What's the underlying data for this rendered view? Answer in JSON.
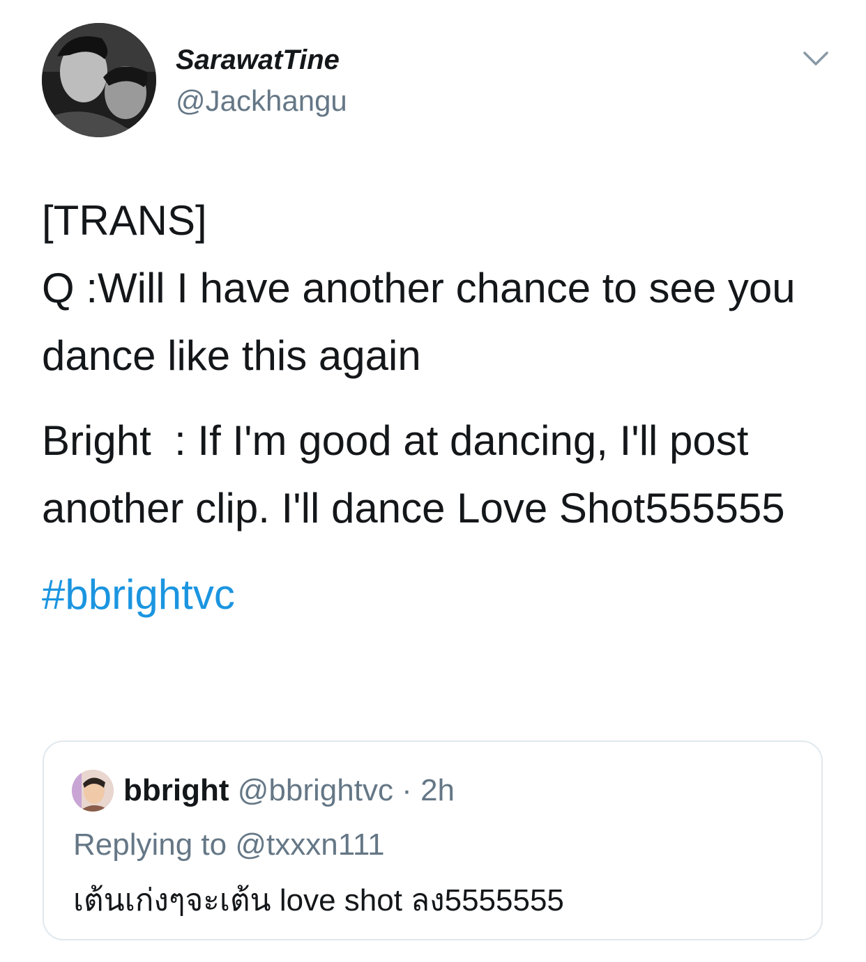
{
  "author": {
    "display_name": "SarawatTine",
    "handle": "@Jackhangu",
    "avatar_icon": "profile-photo"
  },
  "menu": {
    "icon": "chevron-down-icon"
  },
  "tweet": {
    "line1": "[TRANS]",
    "line2": "Q :Will I have another chance to see you dance like this again",
    "line3": "Bright  : If I'm good at dancing, I'll post another clip. I'll dance Love Shot555555",
    "hashtag": "#bbrightvc",
    "hashtag_color": "#1b95e0"
  },
  "quote": {
    "name": "bbright",
    "handle": "@bbrightvc",
    "separator": " · ",
    "time": "2h",
    "replying_prefix": "Replying to ",
    "replying_to": "@txxxn111",
    "text": "เต้นเก่งๆจะเต้น love shot ลง5555555",
    "avatar_icon": "profile-photo"
  },
  "colors": {
    "text": "#14171a",
    "secondary": "#657786",
    "link": "#1b95e0",
    "border": "#e1e8ed"
  }
}
